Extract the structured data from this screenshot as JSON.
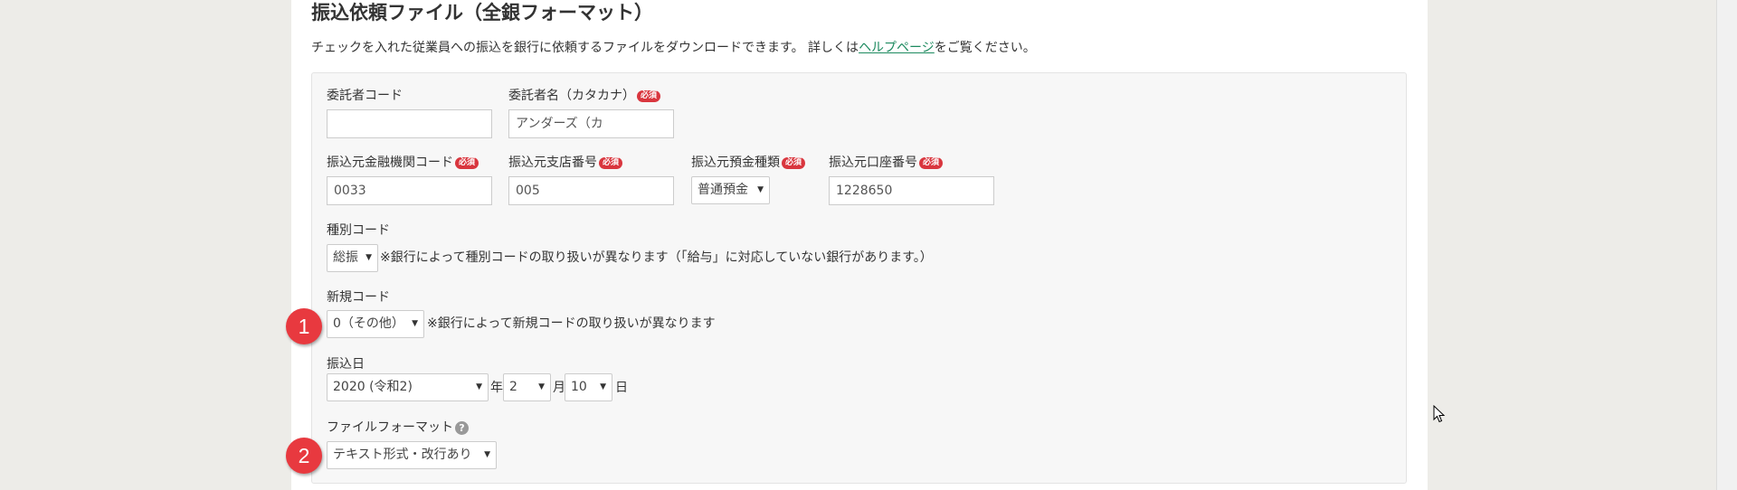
{
  "page": {
    "title": "振込依頼ファイル（全銀フォーマット）",
    "description_prefix": "チェックを入れた従業員への振込を銀行に依頼するファイルをダウンロードできます。 詳しくは",
    "help_link": "ヘルプページ",
    "description_suffix": "をご覧ください。"
  },
  "required_label": "必須",
  "fields": {
    "consignor_code": {
      "label": "委託者コード",
      "value": ""
    },
    "consignor_name": {
      "label": "委託者名（カタカナ）",
      "value": "アンダーズ（カ"
    },
    "bank_code": {
      "label": "振込元金融機関コード",
      "value": "0033"
    },
    "branch_code": {
      "label": "振込元支店番号",
      "value": "005"
    },
    "deposit_type": {
      "label": "振込元預金種類",
      "value": "普通預金"
    },
    "account_number": {
      "label": "振込元口座番号",
      "value": "1228650"
    },
    "type_code": {
      "label": "種別コード",
      "value": "総振",
      "note": "※銀行によって種別コードの取り扱いが異なります（「給与」に対応していない銀行があります。）"
    },
    "new_code": {
      "label": "新規コード",
      "value": "0（その他）",
      "note": "※銀行によって新規コードの取り扱いが異なります"
    },
    "transfer_date": {
      "label": "振込日",
      "year": "2020 (令和2)",
      "year_unit": "年",
      "month": "2",
      "month_unit": "月",
      "day": "10",
      "day_unit": "日"
    },
    "file_format": {
      "label": "ファイルフォーマット",
      "value": "テキスト形式・改行あり",
      "help": "?"
    }
  },
  "annotations": [
    "1",
    "2"
  ],
  "icons": {
    "dropdown": "▼",
    "cursor": "mouse-pointer-icon"
  },
  "colors": {
    "required": "#d9363e",
    "link": "#1d8a5f",
    "badge": "#e8393f"
  }
}
